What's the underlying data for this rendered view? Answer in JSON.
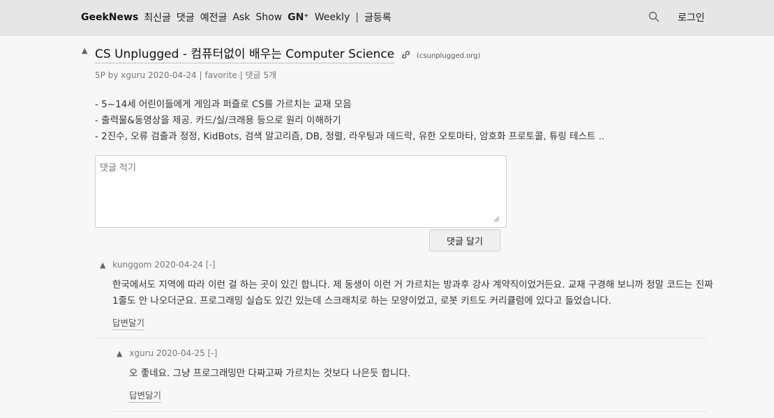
{
  "nav": {
    "brand": "GeekNews",
    "items": [
      "최신글",
      "댓글",
      "예전글",
      "Ask",
      "Show"
    ],
    "gn_plus": "GN⁺",
    "weekly": "Weekly",
    "separator": "|",
    "submit": "글등록",
    "login": "로그인"
  },
  "topic": {
    "title": "CS Unplugged - 컴퓨터없이 배우는 Computer Science",
    "domain": "(csunplugged.org)",
    "points": "5P",
    "by": "by",
    "author": "xguru",
    "date": "2020-04-24",
    "sep": "|",
    "favorite": "favorite",
    "comments": "댓글 5개",
    "desc": [
      "- 5~14세 어린이들에게 게임과 퍼즐로 CS를 가르치는 교재 모음",
      "- 출력물&동영상을 제공. 카드/실/크래용 등으로 원리 이해하기",
      "- 2진수, 오류 검출과 정정, KidBots, 검색 알고리즘, DB, 정렬, 라우팅과 데드락, 유한 오토마타, 암호화 프로토콜, 튜링 테스트 .."
    ]
  },
  "comment_form": {
    "placeholder": "댓글 적기",
    "submit_label": "댓글 달기"
  },
  "comments": [
    {
      "user": "kunggom",
      "time": "2020-04-24",
      "toggle": "[-]",
      "body": [
        "한국에서도 지역에 따라 이런 걸 하는 곳이 있긴 합니다. 제 동생이 이런 거 가르치는 방과후 강사 계약직이었거든요. 교재 구경해 보니까 정말 코드는 진짜",
        "1줄도 안 나오더군요. 프로그래밍 실습도 있긴 있는데 스크래치로 하는 모양이었고, 로봇 키트도 커리큘럼에 있다고 들었습니다."
      ],
      "reply": "답변달기"
    },
    {
      "user": "xguru",
      "time": "2020-04-25",
      "toggle": "[-]",
      "body": [
        "오 좋네요. 그냥 프로그래밍만 다짜고짜 가르치는 것보다 나은듯 합니다."
      ],
      "reply": "답변달기"
    }
  ]
}
